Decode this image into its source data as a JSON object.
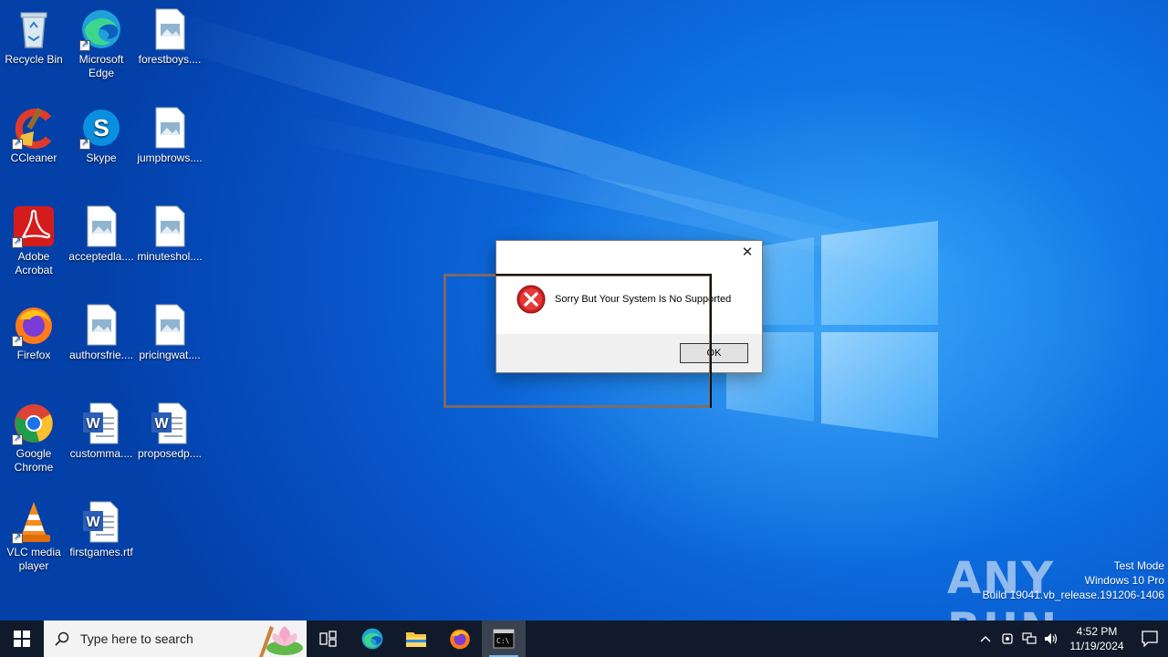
{
  "desktop": {
    "icons": [
      {
        "label": "Recycle Bin",
        "icon": "recycle-bin-icon"
      },
      {
        "label": "Microsoft Edge",
        "icon": "edge-icon"
      },
      {
        "label": "forestboys....",
        "icon": "image-file-icon"
      },
      {
        "label": "CCleaner",
        "icon": "ccleaner-icon"
      },
      {
        "label": "Skype",
        "icon": "skype-icon"
      },
      {
        "label": "jumpbrows....",
        "icon": "image-file-icon"
      },
      {
        "label": "Adobe Acrobat",
        "icon": "acrobat-icon"
      },
      {
        "label": "acceptedla....",
        "icon": "image-file-icon"
      },
      {
        "label": "minuteshol....",
        "icon": "image-file-icon"
      },
      {
        "label": "Firefox",
        "icon": "firefox-icon"
      },
      {
        "label": "authorsfrie....",
        "icon": "image-file-icon"
      },
      {
        "label": "pricingwat....",
        "icon": "image-file-icon"
      },
      {
        "label": "Google Chrome",
        "icon": "chrome-icon"
      },
      {
        "label": "customma....",
        "icon": "word-doc-icon"
      },
      {
        "label": "proposedp....",
        "icon": "word-doc-icon"
      },
      {
        "label": "VLC media player",
        "icon": "vlc-icon"
      },
      {
        "label": "firstgames.rtf",
        "icon": "word-doc-icon"
      }
    ]
  },
  "dialog": {
    "message": "Sorry But Your System Is No Supported",
    "ok_label": "OK",
    "close_glyph": "✕",
    "icon": "error-icon"
  },
  "watermark": {
    "brand": "ANY RUN",
    "line1": "Test Mode",
    "line2": "Windows 10 Pro",
    "line3": "Build 19041.vb_release.191206-1406"
  },
  "taskbar": {
    "search_placeholder": "Type here to search",
    "clock_time": "4:52 PM",
    "clock_date": "11/19/2024",
    "pinned": [
      "task-view-icon",
      "edge-icon",
      "file-explorer-icon",
      "firefox-icon",
      "cmd-icon"
    ]
  }
}
